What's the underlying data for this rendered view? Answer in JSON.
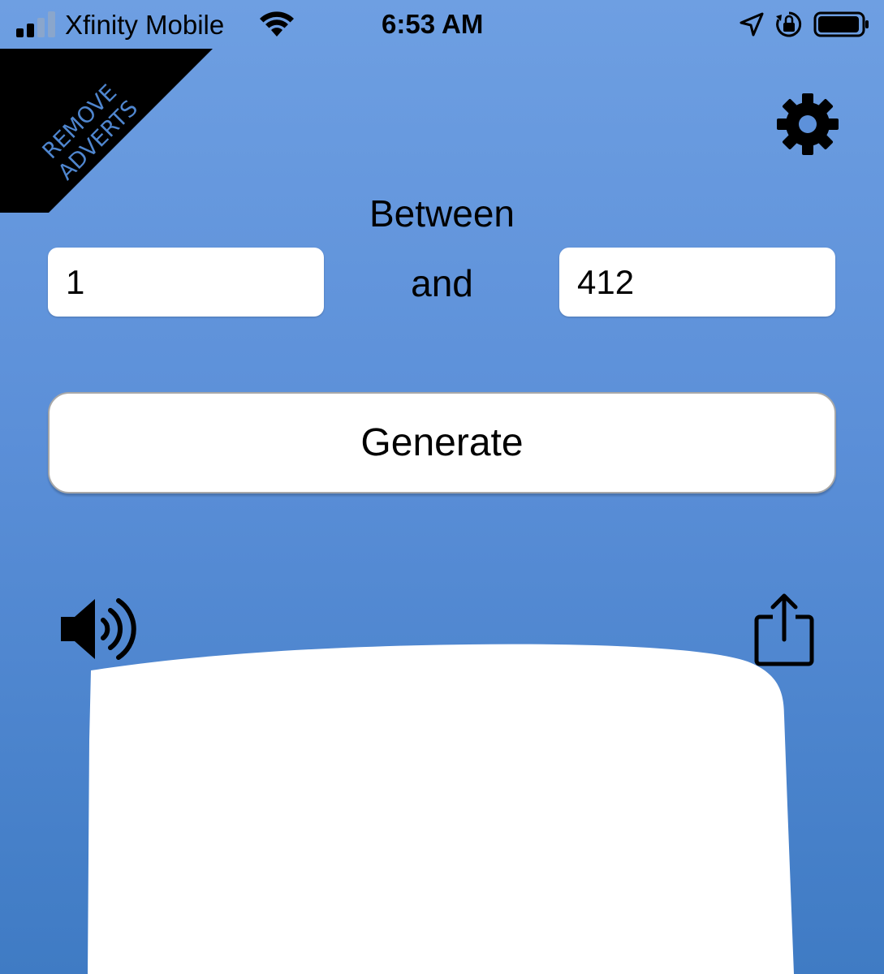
{
  "status_bar": {
    "carrier": "Xfinity Mobile",
    "time": "6:53 AM",
    "signal_bars_filled": 2,
    "signal_bars_total": 4,
    "icons": [
      "signal-icon",
      "wifi-icon",
      "location-icon",
      "rotation-lock-icon",
      "battery-icon"
    ]
  },
  "ad_banner": {
    "label": "REMOVE\nADVERTS"
  },
  "settings": {
    "icon": "gear-icon"
  },
  "range": {
    "between_label": "Between",
    "and_label": "and",
    "min_value": "1",
    "max_value": "412"
  },
  "generate": {
    "label": "Generate"
  },
  "controls": {
    "sound_icon": "speaker-icon",
    "share_icon": "share-icon"
  },
  "colors": {
    "background_top": "#6e9fe2",
    "background_bottom": "#3f7bc4",
    "banner": "#000000",
    "banner_text": "#4f86cf",
    "field_bg": "#ffffff"
  }
}
